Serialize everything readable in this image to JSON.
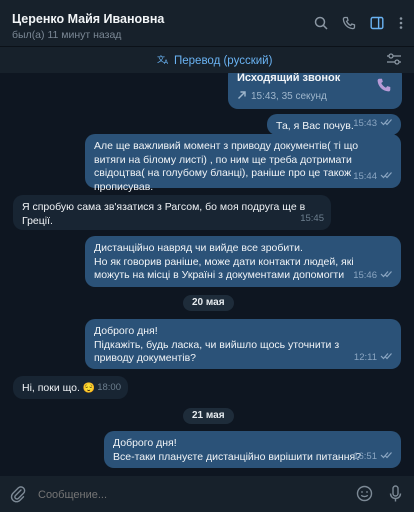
{
  "header": {
    "name": "Церенко Майя Ивановна",
    "status": "был(а) 11 минут назад"
  },
  "translate_bar": {
    "label": "Перевод (русский)"
  },
  "call": {
    "title": "Исходящий звонок",
    "details": "15:43, 35 секунд"
  },
  "messages": [
    {
      "type": "out",
      "text": "Та, я Вас почув.",
      "time": "15:43"
    },
    {
      "type": "out",
      "text": "Але ще важливий момент з приводу документів( ті що витяги на білому листі) , по ним ще треба дотримати свідоцтва( на голубому бланці), раніше про це також прописував.",
      "time": "15:44"
    },
    {
      "type": "in",
      "text": "Я спробую сама зв'язатися з Рагсом, бо моя подруга ще в Греції.",
      "time": "15:45"
    },
    {
      "type": "out",
      "lines": [
        "Дистанційно  навряд чи вийде все зробити.",
        "Но як говорив раніше, може дати контакти людей, які можуть на місці в Україні з документами допомогти"
      ],
      "time": "15:46"
    },
    {
      "type": "out",
      "lines": [
        "Доброго дня!",
        "Підкажіть, будь ласка, чи вийшло щось уточнити з приводу документів?"
      ],
      "time": "12:11"
    },
    {
      "type": "in",
      "text": "Ні, поки що.",
      "emoji": "😌",
      "time": "18:00"
    },
    {
      "type": "out",
      "lines": [
        "Доброго дня!",
        "Все-таки плануєте дистанційно вирішити питання?"
      ],
      "time": "16:51"
    }
  ],
  "date_separators": [
    "20 мая",
    "21 мая"
  ],
  "composer": {
    "placeholder": "Сообщение..."
  },
  "colors": {
    "background": "#0e1621",
    "outgoing": "#2b5278",
    "incoming": "#182533",
    "accent": "#6ab3f3"
  }
}
